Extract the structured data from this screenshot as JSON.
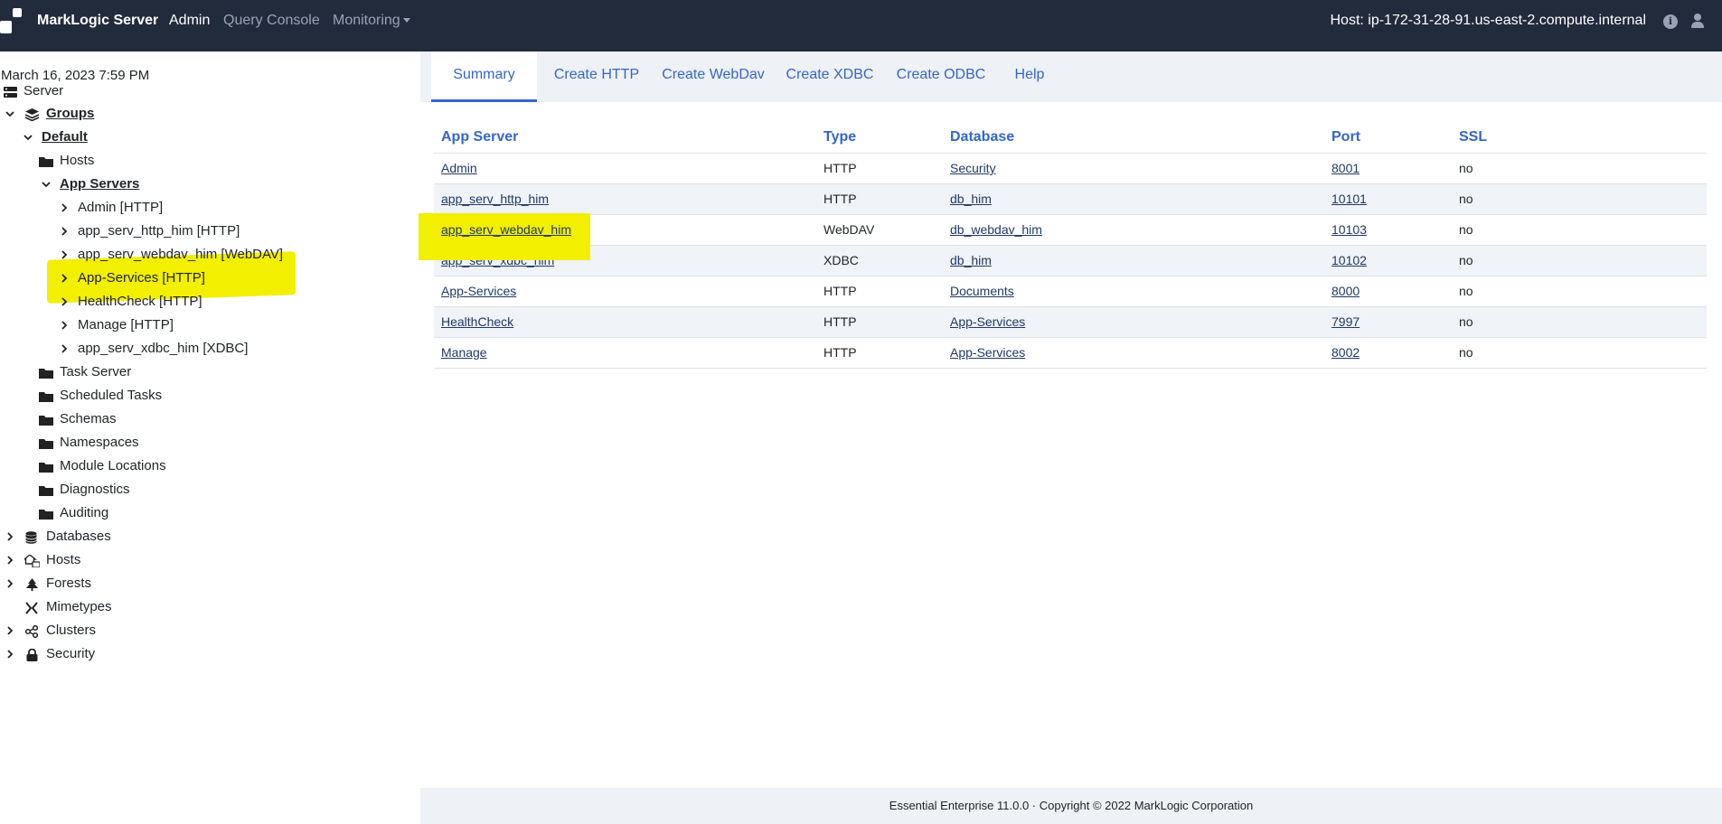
{
  "nav": {
    "brand": "MarkLogic Server",
    "admin": "Admin",
    "query_console": "Query Console",
    "monitoring": "Monitoring",
    "host": "Host: ip-172-31-28-91.us-east-2.compute.internal",
    "info_icon": "info-icon",
    "user_icon": "user-icon"
  },
  "sidebar": {
    "datetime": "March 16, 2023 7:59 PM",
    "tree": {
      "server": "Server",
      "groups": "Groups",
      "default": "Default",
      "hosts": "Hosts",
      "app_servers": "App Servers",
      "admin_http": "Admin [HTTP]",
      "app_serv_http_him": "app_serv_http_him [HTTP]",
      "app_serv_webdav_him": "app_serv_webdav_him [WebDAV]",
      "app_services_http": "App-Services [HTTP]",
      "healthcheck_http": "HealthCheck [HTTP]",
      "manage_http": "Manage [HTTP]",
      "app_serv_xdbc_him": "app_serv_xdbc_him [XDBC]",
      "task_server": "Task Server",
      "scheduled_tasks": "Scheduled Tasks",
      "schemas": "Schemas",
      "namespaces": "Namespaces",
      "module_locations": "Module Locations",
      "diagnostics": "Diagnostics",
      "auditing": "Auditing",
      "databases": "Databases",
      "hosts_top": "Hosts",
      "forests": "Forests",
      "mimetypes": "Mimetypes",
      "clusters": "Clusters",
      "security": "Security"
    }
  },
  "tabs": {
    "summary": "Summary",
    "create_http": "Create HTTP",
    "create_webdav": "Create WebDav",
    "create_xdbc": "Create XDBC",
    "create_odbc": "Create ODBC",
    "help": "Help"
  },
  "table": {
    "headers": {
      "app_server": "App Server",
      "type": "Type",
      "database": "Database",
      "port": "Port",
      "ssl": "SSL"
    },
    "rows": [
      {
        "name": "Admin",
        "type": "HTTP",
        "database": "Security",
        "port": "8001",
        "ssl": "no"
      },
      {
        "name": "app_serv_http_him",
        "type": "HTTP",
        "database": "db_him",
        "port": "10101",
        "ssl": "no"
      },
      {
        "name": "app_serv_webdav_him",
        "type": "WebDAV",
        "database": "db_webdav_him",
        "port": "10103",
        "ssl": "no"
      },
      {
        "name": "app_serv_xdbc_him",
        "type": "XDBC",
        "database": "db_him",
        "port": "10102",
        "ssl": "no"
      },
      {
        "name": "App-Services",
        "type": "HTTP",
        "database": "Documents",
        "port": "8000",
        "ssl": "no"
      },
      {
        "name": "HealthCheck",
        "type": "HTTP",
        "database": "App-Services",
        "port": "7997",
        "ssl": "no"
      },
      {
        "name": "Manage",
        "type": "HTTP",
        "database": "App-Services",
        "port": "8002",
        "ssl": "no"
      }
    ]
  },
  "footer": "Essential Enterprise 11.0.0 · Copyright © 2022 MarkLogic Corporation",
  "colors": {
    "nav_bg": "#222b3c",
    "accent": "#3366cc",
    "highlight": "#f2ef00"
  }
}
